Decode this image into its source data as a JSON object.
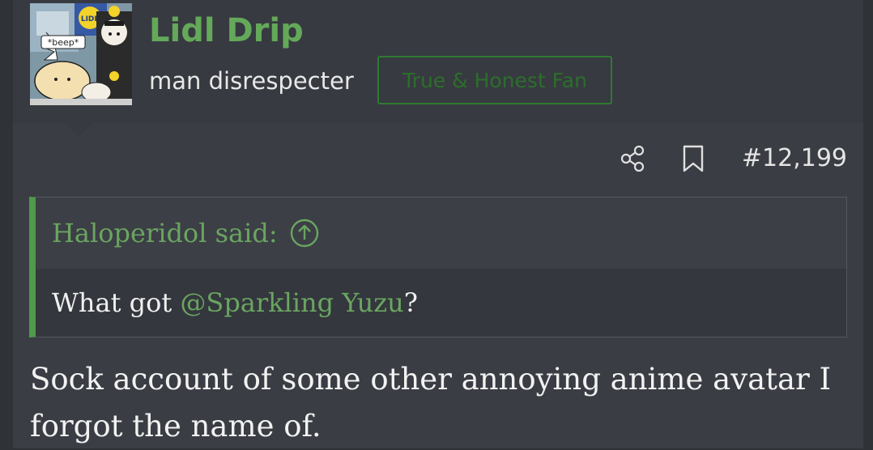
{
  "user": {
    "name": "Lidl Drip",
    "title": "man disrespecter",
    "banner": "True & Honest Fan",
    "avatar_text": "*beep*",
    "avatar_logo_text": "LIDL"
  },
  "post": {
    "number": "#12,199",
    "quote": {
      "attribution": "Haloperidol said:",
      "text_before": "What got ",
      "mention": "@Sparkling Yuzu",
      "text_after": "?"
    },
    "body": "Sock account of some other annoying anime avatar I forgot the name of."
  },
  "icons": {
    "share": "share-icon",
    "bookmark": "bookmark-icon",
    "jump": "arrow-up-circle-icon"
  },
  "colors": {
    "accent_green": "#64a95a",
    "quote_bar": "#4f9a4b",
    "banner_border": "#2f7a31",
    "background": "#3a3d43"
  }
}
